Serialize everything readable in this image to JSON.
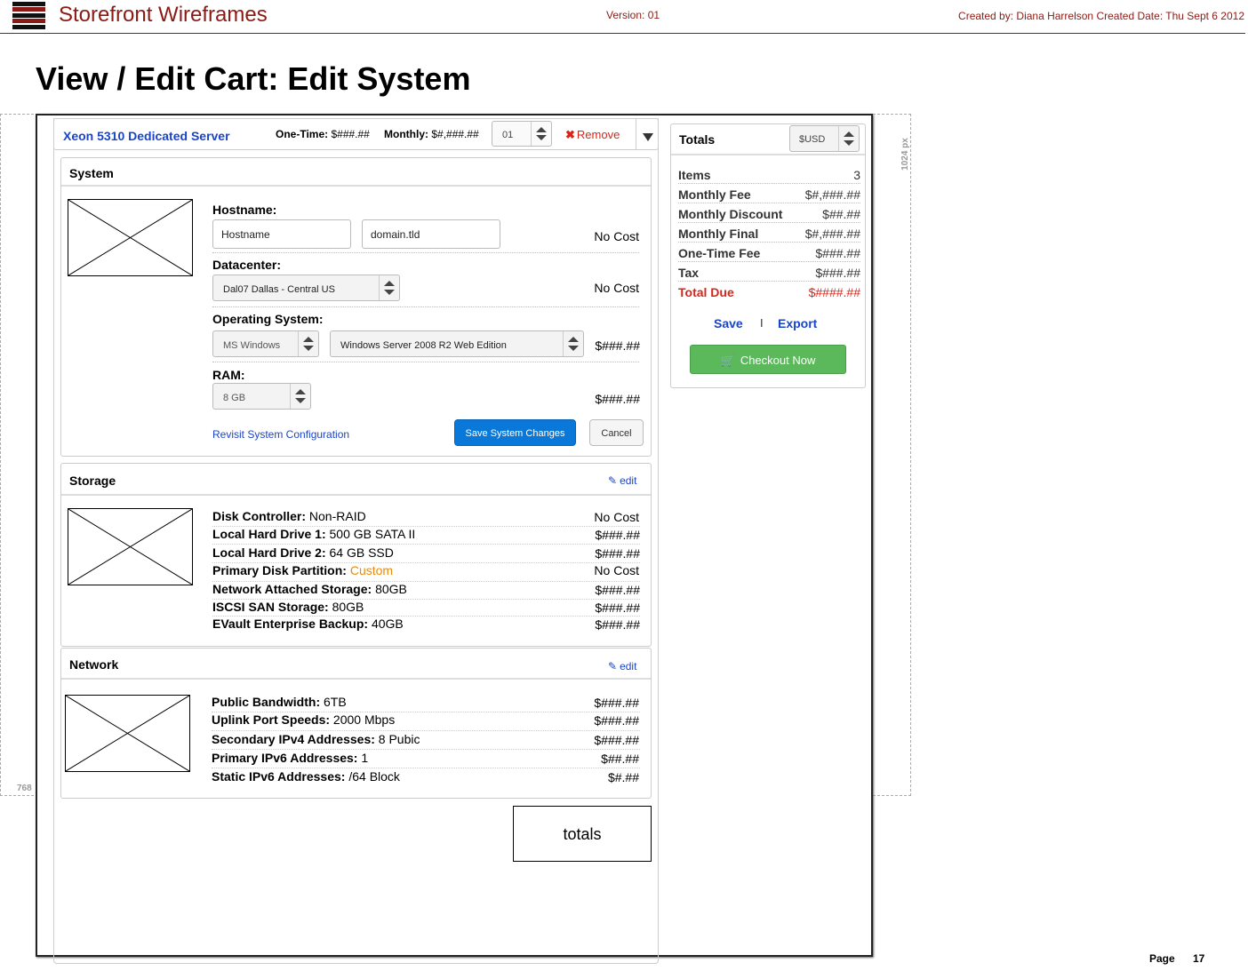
{
  "header": {
    "app_title": "Storefront Wireframes",
    "version": "Version: 01",
    "created": "Created by: Diana Harrelson  Created Date: Thu Sept 6 2012"
  },
  "page_title": "View / Edit Cart: Edit System",
  "guides": {
    "height_label": "768",
    "width_label": "1024 px"
  },
  "product": {
    "name": "Xeon 5310 Dedicated Server",
    "onetime_label": "One-Time:",
    "onetime_value": "$###.##",
    "monthly_label": "Monthly:",
    "monthly_value": "$#,###.##",
    "quantity": "01",
    "remove_label": "Remove"
  },
  "system": {
    "title": "System",
    "hostname_label": "Hostname:",
    "hostname_value": "Hostname",
    "domain_value": "domain.tld",
    "hostname_cost": "No Cost",
    "datacenter_label": "Datacenter:",
    "datacenter_value": "Dal07 Dallas - Central US",
    "datacenter_cost": "No Cost",
    "os_label": "Operating System:",
    "os_family": "MS Windows",
    "os_version": "Windows Server 2008 R2 Web Edition",
    "os_cost": "$###.##",
    "ram_label": "RAM:",
    "ram_value": "8 GB",
    "ram_cost": "$###.##",
    "revisit_link": "Revisit System Configuration",
    "save_button": "Save System Changes",
    "cancel_button": "Cancel"
  },
  "storage": {
    "title": "Storage",
    "edit_label": "edit",
    "rows": [
      {
        "label": "Disk Controller:",
        "value": "Non-RAID",
        "cost": "No Cost"
      },
      {
        "label": "Local Hard Drive 1:",
        "value": "500 GB SATA II",
        "cost": "$###.##"
      },
      {
        "label": "Local Hard Drive 2:",
        "value": "64 GB SSD",
        "cost": "$###.##"
      },
      {
        "label": "Primary Disk Partition:",
        "value": "Custom",
        "cost": "No Cost"
      },
      {
        "label": "Network Attached Storage:",
        "value": "80GB",
        "cost": "$###.##"
      },
      {
        "label": "ISCSI SAN Storage:",
        "value": "80GB",
        "cost": "$###.##"
      },
      {
        "label": "EVault Enterprise Backup:",
        "value": "40GB",
        "cost": "$###.##"
      }
    ]
  },
  "network": {
    "title": "Network",
    "edit_label": "edit",
    "rows": [
      {
        "label": "Public Bandwidth:",
        "value": "6TB",
        "cost": "$###.##"
      },
      {
        "label": "Uplink Port Speeds:",
        "value": "2000 Mbps",
        "cost": "$###.##"
      },
      {
        "label": "Secondary IPv4 Addresses:",
        "value": "8 Pubic",
        "cost": "$###.##"
      },
      {
        "label": "Primary IPv6 Addresses:",
        "value": "1",
        "cost": "$##.##"
      },
      {
        "label": "Static IPv6 Addresses:",
        "value": "/64 Block",
        "cost": "$#.##"
      }
    ]
  },
  "totals_placeholder": "totals",
  "totals": {
    "title": "Totals",
    "currency": "$USD",
    "rows": [
      {
        "label": "Items",
        "value": "3"
      },
      {
        "label": "Monthly Fee",
        "value": "$#,###.##"
      },
      {
        "label": "Monthly Discount",
        "value": "$##.##"
      },
      {
        "label": "Monthly Final",
        "value": "$#,###.##"
      },
      {
        "label": "One-Time Fee",
        "value": "$###.##"
      },
      {
        "label": "Tax",
        "value": "$###.##"
      },
      {
        "label": "Total Due",
        "value": "$####.##"
      }
    ],
    "save_link": "Save",
    "separator": "I",
    "export_link": "Export",
    "checkout_button": "Checkout Now"
  },
  "footer": {
    "page_label": "Page",
    "page_number": "17"
  },
  "colors": {
    "brand": "#8c1a14",
    "link": "#1a44c8",
    "danger": "#d8251a",
    "primary": "#0a78d8",
    "checkout": "#5bb85b",
    "accent_orange": "#e88a0c"
  }
}
